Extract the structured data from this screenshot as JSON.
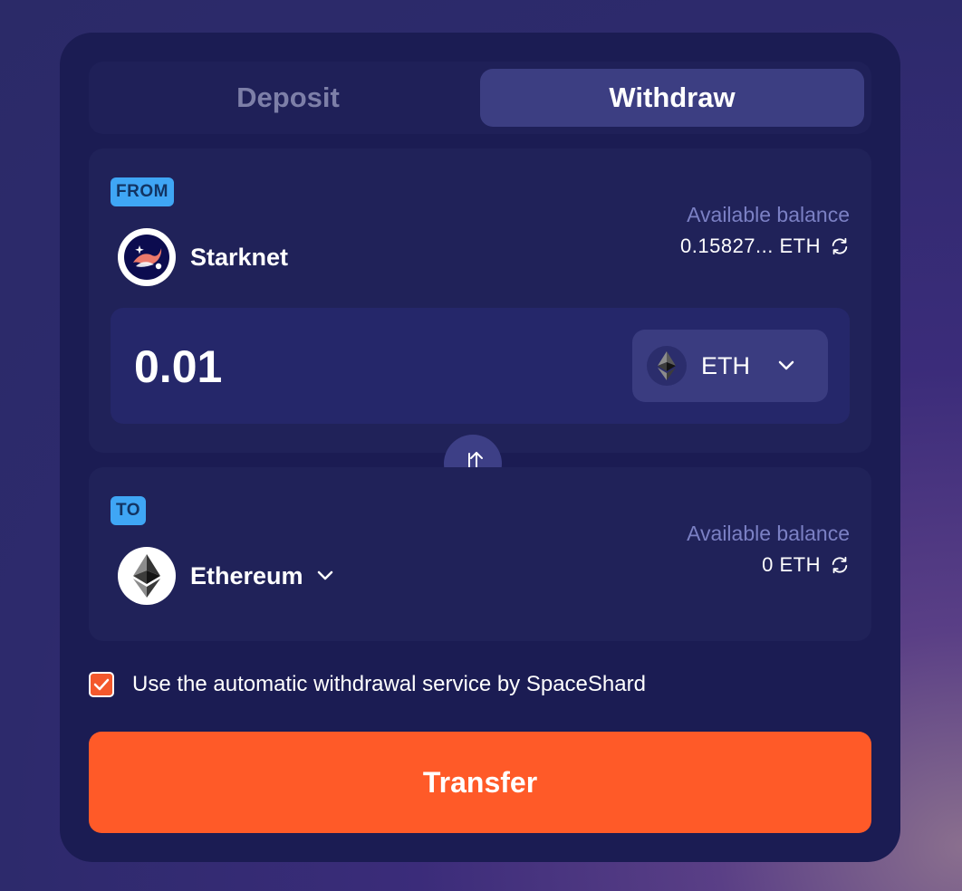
{
  "tabs": {
    "deposit": "Deposit",
    "withdraw": "Withdraw",
    "active": "Withdraw"
  },
  "from": {
    "badge": "FROM",
    "network": "Starknet",
    "network_icon": "starknet-logo",
    "balance_label": "Available balance",
    "balance_value": "0.15827... ETH"
  },
  "amount": {
    "value": "0.01",
    "token": "ETH",
    "token_icon": "eth-icon"
  },
  "to": {
    "badge": "TO",
    "network": "Ethereum",
    "network_icon": "ethereum-logo",
    "balance_label": "Available balance",
    "balance_value": "0 ETH"
  },
  "options": {
    "auto_withdraw_label": "Use the automatic withdrawal service by SpaceShard",
    "auto_withdraw_checked": true
  },
  "actions": {
    "transfer_label": "Transfer"
  },
  "colors": {
    "card_bg": "#1b1c53",
    "section_bg": "#202259",
    "accent": "#ff5a28",
    "badge": "#3fa6f5",
    "muted_label": "#7b80c4"
  }
}
